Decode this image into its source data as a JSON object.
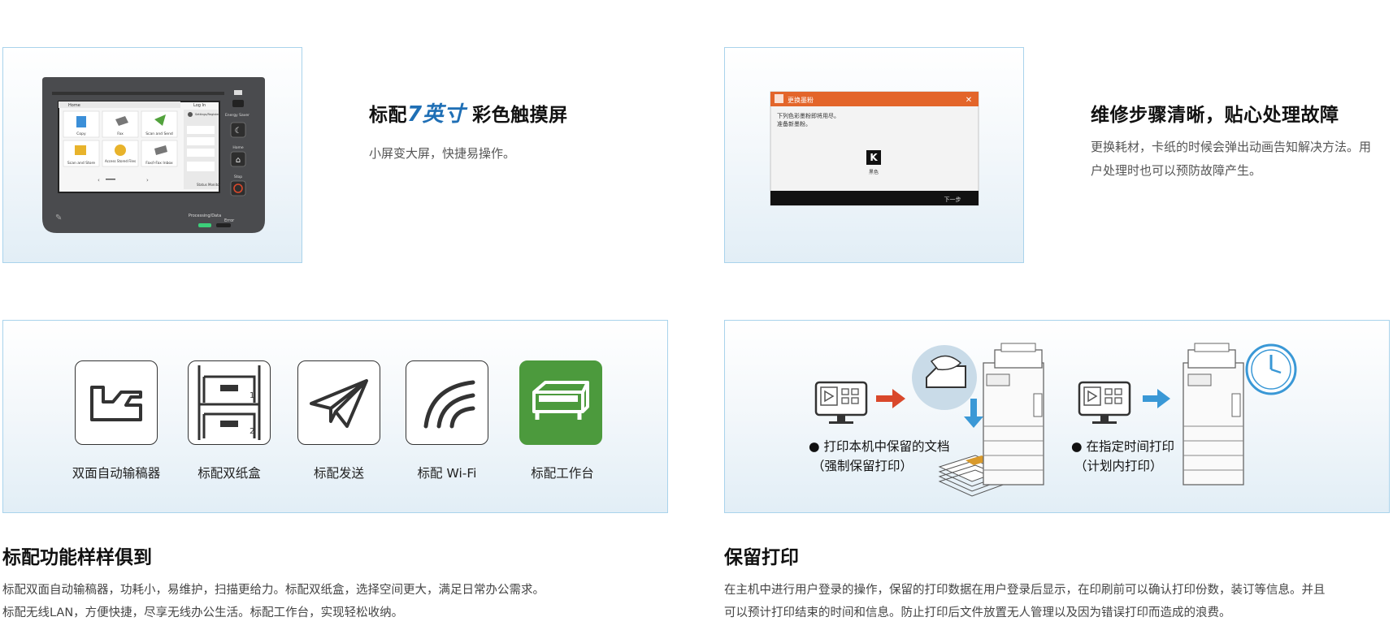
{
  "features": [
    {
      "title_before": "标配",
      "title_accent": "7英寸",
      "title_after": "彩色触摸屏",
      "description": "小屏变大屏，快捷易操作。",
      "screen": {
        "home_label": "Home",
        "login_label": "Log In",
        "tiles": [
          "Copy",
          "Fax",
          "Scan and Send",
          "Scan and Store",
          "Access Stored Files",
          "Fax/I-Fax Inbox"
        ],
        "side_buttons": [
          "Energy Saver",
          "Home",
          "Stop"
        ],
        "status_label": "Status Monitor",
        "processing_label": "Processing/Data",
        "error_label": "Error",
        "settings_label": "Settings/Register"
      }
    },
    {
      "title": "维修步骤清晰，贴心处理故障",
      "description_lines": [
        "更换耗材，卡纸的时候会弹出动画告知解决方法。用",
        "户处理时也可以预防故障产生。"
      ],
      "dialog": {
        "header": "更换墨粉",
        "message_lines": [
          "下列色彩墨粉即将用尽。",
          "准备新墨粉。"
        ],
        "toner_letter": "K",
        "toner_label": "黑色",
        "next_label": "下一步"
      }
    }
  ],
  "standard_features": {
    "items": [
      {
        "label": "双面自动输稿器",
        "icon": "document-feeder-icon"
      },
      {
        "label": "标配双纸盒",
        "icon": "paper-cassette-icon"
      },
      {
        "label": "标配发送",
        "icon": "send-plane-icon"
      },
      {
        "label": "标配 Wi-Fi",
        "icon": "wifi-icon"
      },
      {
        "label": "标配工作台",
        "icon": "cabinet-icon"
      }
    ],
    "cassette_numbers": [
      "1",
      "2"
    ],
    "title": "标配功能样样俱到",
    "description_lines": [
      "标配双面自动输稿器，功耗小，易维护，扫描更给力。标配双纸盒，选择空间更大，满足日常办公需求。",
      "标配无线LAN，方便快捷，尽享无线办公生活。标配工作台，实现轻松收纳。"
    ]
  },
  "hold_print": {
    "label1_line1": "● 打印本机中保留的文档",
    "label1_line2": "（强制保留打印）",
    "label2_line1": "● 在指定时间打印",
    "label2_line2": "（计划内打印）",
    "title": "保留打印",
    "description_lines": [
      "在主机中进行用户登录的操作，保留的打印数据在用户登录后显示，在印刷前可以确认打印份数，装订等信息。并且",
      "可以预计打印结束的时间和信息。防止打印后文件放置无人管理以及因为错误打印而造成的浪费。"
    ]
  },
  "colors": {
    "accent": "#1f6fb5",
    "card_border": "#a9d3ec",
    "dialog_header": "#e3652a",
    "arrow_red": "#d9482b",
    "arrow_blue": "#3a98d6",
    "cabinet_green": "#4c9a3d"
  }
}
